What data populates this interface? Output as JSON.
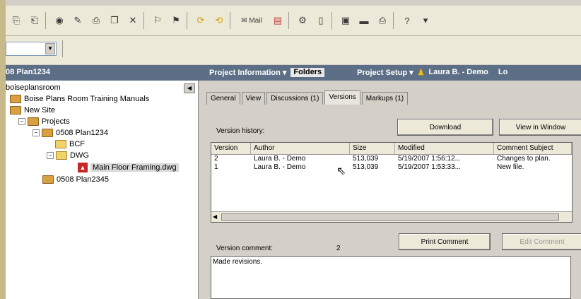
{
  "toolbar": {
    "icons": [
      "export-icon",
      "import-icon",
      "color-icon",
      "pin-icon",
      "print-icon",
      "copy-icon",
      "delete-icon",
      "flag-icon",
      "flag2-icon",
      "refresh-icon",
      "refresh2-icon",
      "mail-icon",
      "chart-icon",
      "settings-icon",
      "doc-icon",
      "drive-icon",
      "save-icon",
      "printer-icon",
      "help-icon"
    ],
    "mail_label": "Mail",
    "help_dropdown": "▾"
  },
  "titlebar": {
    "left": "08 Plan1234",
    "menu": [
      "Project Information ▾",
      "Folders",
      "Project Setup ▾",
      "Laura B. - Demo",
      "Lo"
    ]
  },
  "tree": {
    "nodes": [
      {
        "label": "boiseplansroom"
      },
      {
        "label": "Boise Plans Room Training Manuals"
      },
      {
        "label": "New Site"
      },
      {
        "label": "Projects"
      },
      {
        "label": "0508 Plan1234"
      },
      {
        "label": "BCF"
      },
      {
        "label": "DWG"
      },
      {
        "label": "Main Floor Framing.dwg"
      },
      {
        "label": "0508 Plan2345"
      }
    ]
  },
  "tabs": [
    "General",
    "View",
    "Discussions (1)",
    "Versions",
    "Markups (1)"
  ],
  "versions": {
    "history_label": "Version history:",
    "download": "Download",
    "view_in_window": "View in Window",
    "columns": [
      "Version",
      "Author",
      "Size",
      "Modified",
      "Comment Subject"
    ],
    "rows": [
      [
        "2",
        "Laura B. - Demo",
        "513,039",
        "5/19/2007  1:56:12...",
        "Changes to plan."
      ],
      [
        "1",
        "Laura B. - Demo",
        "513,039",
        "5/19/2007  1:53:33...",
        "New file."
      ]
    ],
    "comment_label": "Version comment:",
    "comment_version": "2",
    "print_comment": "Print Comment",
    "edit_comment": "Edit Comment",
    "comment_text": "Made revisions."
  }
}
